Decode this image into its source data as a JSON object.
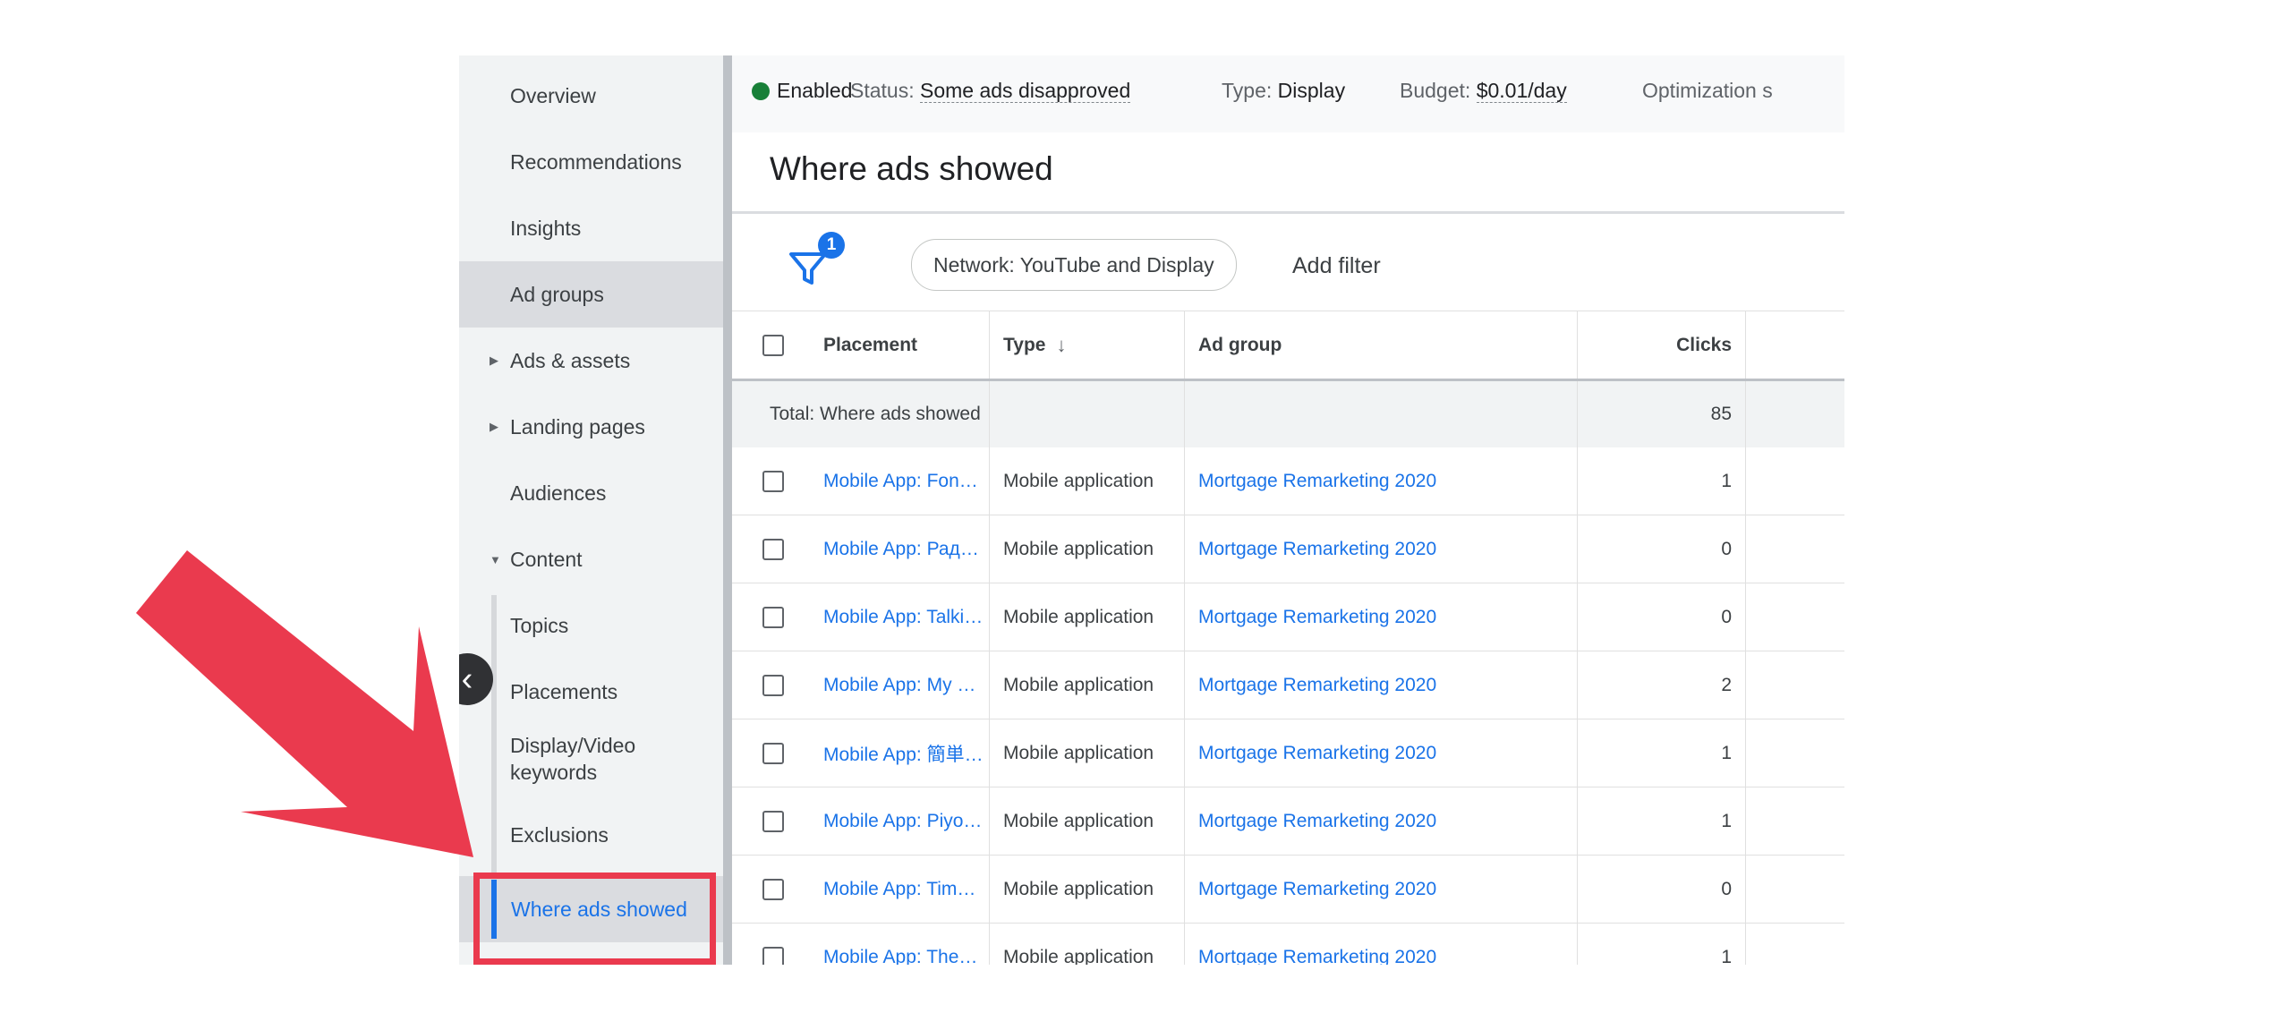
{
  "sidebar": {
    "items": [
      {
        "label": "Overview"
      },
      {
        "label": "Recommendations"
      },
      {
        "label": "Insights"
      },
      {
        "label": "Ad groups"
      },
      {
        "label": "Ads & assets"
      },
      {
        "label": "Landing pages"
      },
      {
        "label": "Audiences"
      },
      {
        "label": "Content"
      },
      {
        "label": "Topics"
      },
      {
        "label": "Placements"
      },
      {
        "label": "Display/Video keywords"
      },
      {
        "label": "Exclusions"
      },
      {
        "label": "Where ads showed"
      }
    ],
    "collapse_icon": "chevron-left-icon"
  },
  "status_bar": {
    "enabled_label": "Enabled",
    "status_key": "Status:",
    "status_value": "Some ads disapproved",
    "type_key": "Type:",
    "type_value": "Display",
    "budget_key": "Budget:",
    "budget_value": "$0.01/day",
    "optimization_label": "Optimization s"
  },
  "page_title": "Where ads showed",
  "filters": {
    "badge_count": "1",
    "network_chip": "Network: YouTube and Display",
    "add_filter": "Add filter"
  },
  "table": {
    "headers": {
      "placement": "Placement",
      "type": "Type",
      "ad_group": "Ad group",
      "clicks": "Clicks"
    },
    "total": {
      "label": "Total: Where ads showed",
      "clicks": "85"
    },
    "rows": [
      {
        "placement": "Mobile App: Fon…",
        "type": "Mobile application",
        "ad_group": "Mortgage Remarketing 2020",
        "clicks": "1"
      },
      {
        "placement": "Mobile App: Рад…",
        "type": "Mobile application",
        "ad_group": "Mortgage Remarketing 2020",
        "clicks": "0"
      },
      {
        "placement": "Mobile App: Talki…",
        "type": "Mobile application",
        "ad_group": "Mortgage Remarketing 2020",
        "clicks": "0"
      },
      {
        "placement": "Mobile App: My …",
        "type": "Mobile application",
        "ad_group": "Mortgage Remarketing 2020",
        "clicks": "2"
      },
      {
        "placement": "Mobile App: 簡単…",
        "type": "Mobile application",
        "ad_group": "Mortgage Remarketing 2020",
        "clicks": "1"
      },
      {
        "placement": "Mobile App: Piyo…",
        "type": "Mobile application",
        "ad_group": "Mortgage Remarketing 2020",
        "clicks": "1"
      },
      {
        "placement": "Mobile App: Tim…",
        "type": "Mobile application",
        "ad_group": "Mortgage Remarketing 2020",
        "clicks": "0"
      },
      {
        "placement": "Mobile App: The…",
        "type": "Mobile application",
        "ad_group": "Mortgage Remarketing 2020",
        "clicks": "1"
      }
    ]
  },
  "colors": {
    "accent": "#1a73e8",
    "enabled_dot": "#188038",
    "annotation_red": "#ea3a4e"
  }
}
